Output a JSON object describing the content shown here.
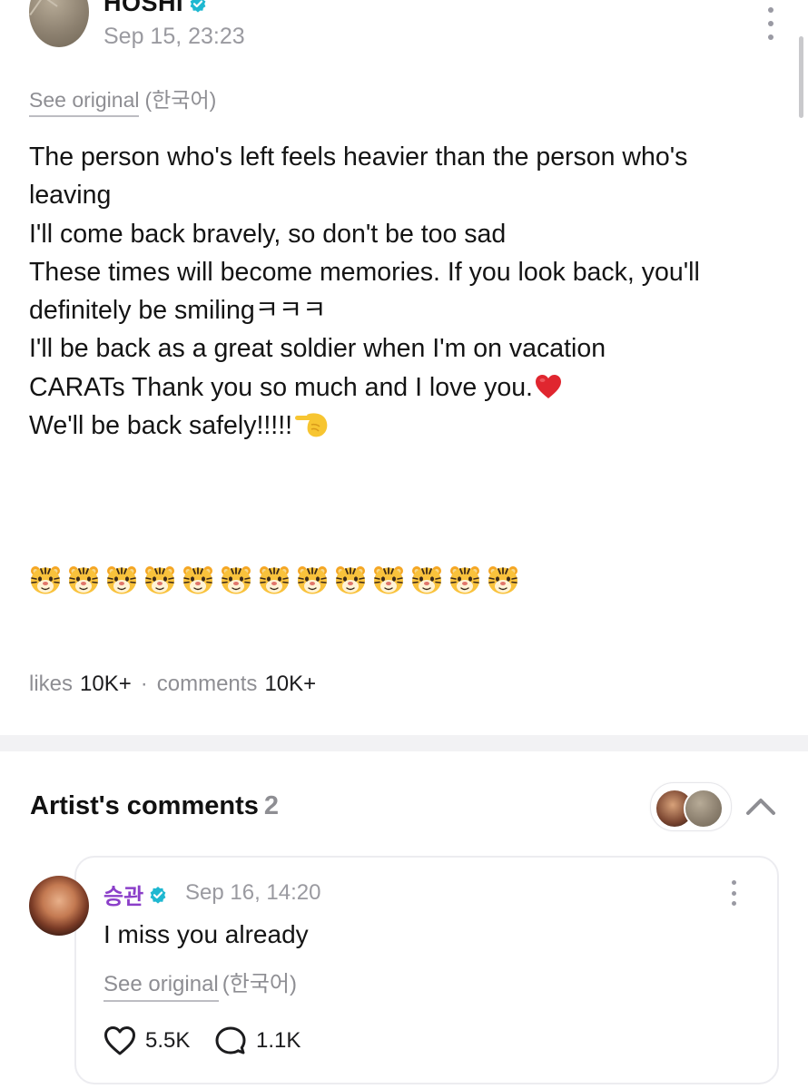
{
  "post": {
    "author": "HOSHI",
    "timestamp": "Sep 15, 23:23",
    "see_original": "See original",
    "original_language": "(한국어)",
    "body_lines": [
      "The person who's left feels heavier than the person who's",
      "leaving",
      "I'll come back bravely, so don't be too sad",
      "These times will become memories. If you look back, you'll",
      "definitely be smilingㅋㅋㅋ",
      "I'll be back as a great soldier when I'm on vacation",
      "CARATs Thank you so much and I love you.",
      "We'll be back safely!!!!!"
    ],
    "tiger_emoji_count": 13,
    "stats": {
      "likes_label": "likes",
      "likes_value": "10K+",
      "separator": "·",
      "comments_label": "comments",
      "comments_value": "10K+"
    }
  },
  "artist_comments": {
    "title": "Artist's comments",
    "count": "2",
    "comment": {
      "author": "승관",
      "timestamp": "Sep 16, 14:20",
      "text": "I miss you already",
      "see_original": "See original",
      "original_language": "(한국어)",
      "likes": "5.5K",
      "replies": "1.1K"
    }
  },
  "colors": {
    "verified_badge": "#1fb8d1",
    "comment_author": "#8b3fc9",
    "heart_emoji": "#e0262f",
    "muted_text": "#8e8e93"
  }
}
